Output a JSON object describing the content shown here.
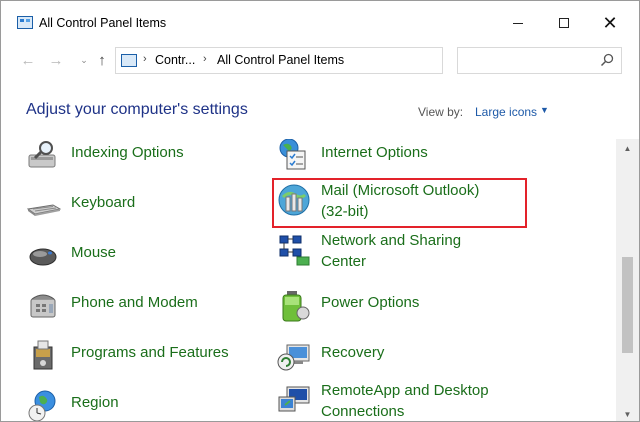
{
  "window": {
    "title": "All Control Panel Items",
    "controls": {
      "minimize": "minimize",
      "maximize": "maximize",
      "close": "✕"
    }
  },
  "address": {
    "crumb1": "Contr...",
    "crumb2": "All Control Panel Items",
    "search_placeholder": ""
  },
  "header": {
    "title": "Adjust your computer's settings",
    "view_by_label": "View by:",
    "view_by_value": "Large icons"
  },
  "items": {
    "left": [
      {
        "label": "Indexing Options",
        "icon": "indexing-icon"
      },
      {
        "label": "Keyboard",
        "icon": "keyboard-icon"
      },
      {
        "label": "Mouse",
        "icon": "mouse-icon"
      },
      {
        "label": "Phone and Modem",
        "icon": "phone-icon"
      },
      {
        "label": "Programs and Features",
        "icon": "programs-icon"
      },
      {
        "label": "Region",
        "icon": "region-icon"
      }
    ],
    "right": [
      {
        "label": "Internet Options",
        "icon": "internet-options-icon"
      },
      {
        "label": "Mail (Microsoft Outlook)",
        "label2": "(32-bit)",
        "icon": "mail-icon"
      },
      {
        "label": "Network and Sharing",
        "label2": "Center",
        "icon": "network-icon"
      },
      {
        "label": "Power Options",
        "icon": "power-icon"
      },
      {
        "label": "Recovery",
        "icon": "recovery-icon"
      },
      {
        "label": "RemoteApp and Desktop",
        "label2": "Connections",
        "icon": "remoteapp-icon"
      }
    ]
  },
  "colors": {
    "link_green": "#1a6e1a",
    "heading_blue": "#1e3287",
    "highlight_red": "#e3222a"
  }
}
